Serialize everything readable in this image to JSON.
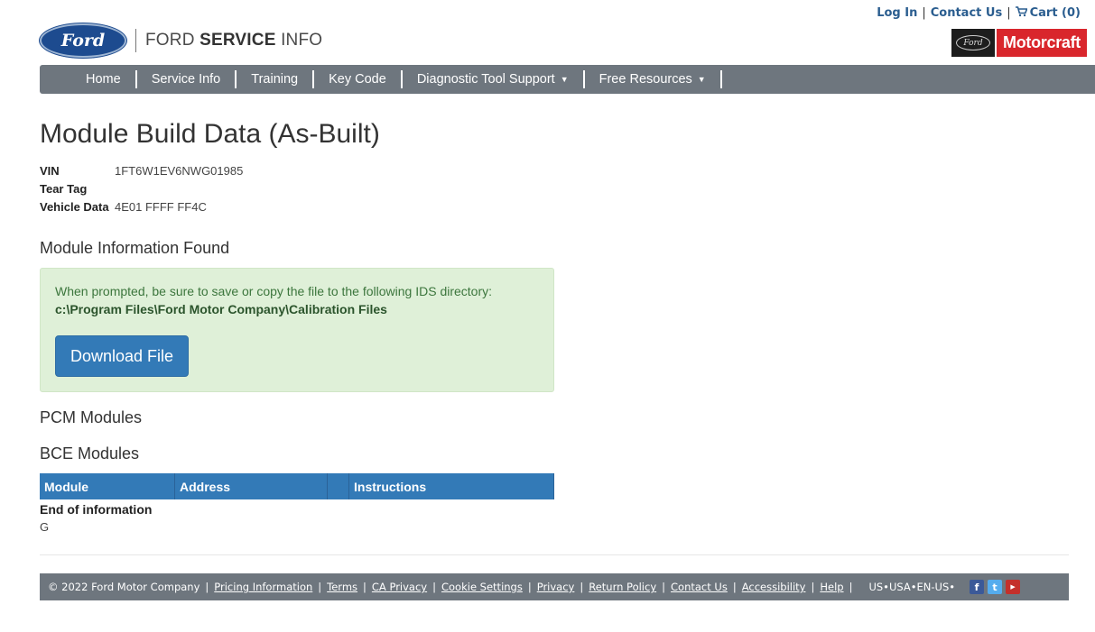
{
  "header": {
    "login": "Log In",
    "contact": "Contact Us",
    "cart": "Cart (0)",
    "logo_oval": "Ford",
    "logo_text_light": "FORD ",
    "logo_text_bold": "SERVICE",
    "logo_text_end": " INFO",
    "motorcraft_ford": "Ford",
    "motorcraft_name": "Motorcraft"
  },
  "nav": {
    "items": [
      {
        "label": "Home"
      },
      {
        "label": "Service Info"
      },
      {
        "label": "Training"
      },
      {
        "label": "Key Code"
      },
      {
        "label": "Diagnostic Tool Support",
        "dropdown": true
      },
      {
        "label": "Free Resources",
        "dropdown": true
      }
    ]
  },
  "page": {
    "title": "Module Build Data (As-Built)",
    "vin_label": "VIN",
    "vin_value": "1FT6W1EV6NWG01985",
    "teartag_label": "Tear Tag",
    "teartag_value": "",
    "vehicle_label": "Vehicle Data",
    "vehicle_value": "4E01 FFFF FF4C",
    "module_info_heading": "Module Information Found",
    "prompt_text": "When prompted, be sure to save or copy the file to the following IDS directory:",
    "ids_path": "c:\\Program Files\\Ford Motor Company\\Calibration Files",
    "download_label": "Download File",
    "pcm_heading": "PCM Modules",
    "bce_heading": "BCE Modules",
    "table_headers": [
      "Module",
      "Address",
      "",
      "Instructions"
    ],
    "end_info": "End of information",
    "end_code": "G"
  },
  "footer": {
    "copyright": "© 2022 Ford Motor Company",
    "links": [
      "Pricing Information",
      "Terms",
      "CA Privacy",
      "Cookie Settings",
      "Privacy",
      "Return Policy",
      "Contact Us",
      "Accessibility",
      "Help"
    ],
    "locale": "US•USA•EN-US•",
    "social_icons": [
      "facebook-icon",
      "twitter-icon",
      "youtube-icon"
    ]
  },
  "colors": {
    "nav_bg": "#6e767e",
    "primary": "#337ab7",
    "success_bg": "#dff0d8",
    "motorcraft_red": "#d9262c",
    "link": "#2a5d8f"
  }
}
